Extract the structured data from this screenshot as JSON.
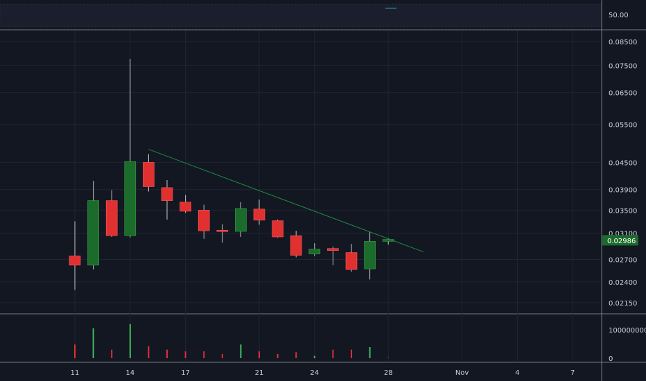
{
  "chart_data": {
    "type": "candlestick",
    "scale": "log",
    "price_ticks": [
      "0.08500",
      "0.07500",
      "0.06500",
      "0.05500",
      "0.04500",
      "0.03900",
      "0.03500",
      "0.03100",
      "0.02700",
      "0.02400",
      "0.02150"
    ],
    "volume_ticks": [
      "100000000",
      "0"
    ],
    "indicator_tick": "50.00",
    "x_tick_labels": [
      {
        "label": "11",
        "bar": 0
      },
      {
        "label": "14",
        "bar": 3
      },
      {
        "label": "17",
        "bar": 6
      },
      {
        "label": "21",
        "bar": 10
      },
      {
        "label": "24",
        "bar": 13
      },
      {
        "label": "28",
        "bar": 17
      },
      {
        "label": "Nov",
        "bar": 21
      },
      {
        "label": "4",
        "bar": 24
      },
      {
        "label": "7",
        "bar": 27
      }
    ],
    "last_price": "0.02986",
    "candles": [
      {
        "open": 0.0275,
        "high": 0.033,
        "low": 0.023,
        "close": 0.0262,
        "volume": 48000000
      },
      {
        "open": 0.0262,
        "high": 0.0408,
        "low": 0.0256,
        "close": 0.0368,
        "volume": 105000000
      },
      {
        "open": 0.0368,
        "high": 0.0389,
        "low": 0.0304,
        "close": 0.0306,
        "volume": 30000000
      },
      {
        "open": 0.0306,
        "high": 0.0776,
        "low": 0.0303,
        "close": 0.0452,
        "volume": 120000000
      },
      {
        "open": 0.045,
        "high": 0.047,
        "low": 0.0386,
        "close": 0.0396,
        "volume": 42000000
      },
      {
        "open": 0.0394,
        "high": 0.041,
        "low": 0.0333,
        "close": 0.0368,
        "volume": 30000000
      },
      {
        "open": 0.0365,
        "high": 0.0379,
        "low": 0.0345,
        "close": 0.0348,
        "volume": 24000000
      },
      {
        "open": 0.035,
        "high": 0.036,
        "low": 0.0301,
        "close": 0.0314,
        "volume": 24000000
      },
      {
        "open": 0.0315,
        "high": 0.0325,
        "low": 0.0295,
        "close": 0.0314,
        "volume": 15000000
      },
      {
        "open": 0.0313,
        "high": 0.0365,
        "low": 0.0304,
        "close": 0.0353,
        "volume": 48000000
      },
      {
        "open": 0.0352,
        "high": 0.037,
        "low": 0.0324,
        "close": 0.0332,
        "volume": 24000000
      },
      {
        "open": 0.0331,
        "high": 0.0333,
        "low": 0.0303,
        "close": 0.0304,
        "volume": 15000000
      },
      {
        "open": 0.0306,
        "high": 0.0314,
        "low": 0.0273,
        "close": 0.0276,
        "volume": 21000000
      },
      {
        "open": 0.0278,
        "high": 0.0294,
        "low": 0.0275,
        "close": 0.0285,
        "volume": 8000000
      },
      {
        "open": 0.0286,
        "high": 0.0289,
        "low": 0.0262,
        "close": 0.0283,
        "volume": 30000000
      },
      {
        "open": 0.028,
        "high": 0.0293,
        "low": 0.0253,
        "close": 0.0256,
        "volume": 30000000
      },
      {
        "open": 0.0257,
        "high": 0.0312,
        "low": 0.0243,
        "close": 0.0297,
        "volume": 39000000
      },
      {
        "open": 0.0297,
        "high": 0.0302,
        "low": 0.0292,
        "close": 0.03,
        "volume": 1000000
      }
    ],
    "trendline": [
      {
        "bar": 4,
        "price": 0.0482
      },
      {
        "bar": 18.9,
        "price": 0.0281
      }
    ],
    "colors": {
      "background": "#131722",
      "up": "#26a69a",
      "up_body": "#1b6b2a",
      "down": "#e03030",
      "trendline": "#1e8d3e",
      "grid": "#1f2533",
      "separator": "#787b86",
      "text": "#d1d4dc",
      "price_badge": "#1b6b2a"
    }
  }
}
